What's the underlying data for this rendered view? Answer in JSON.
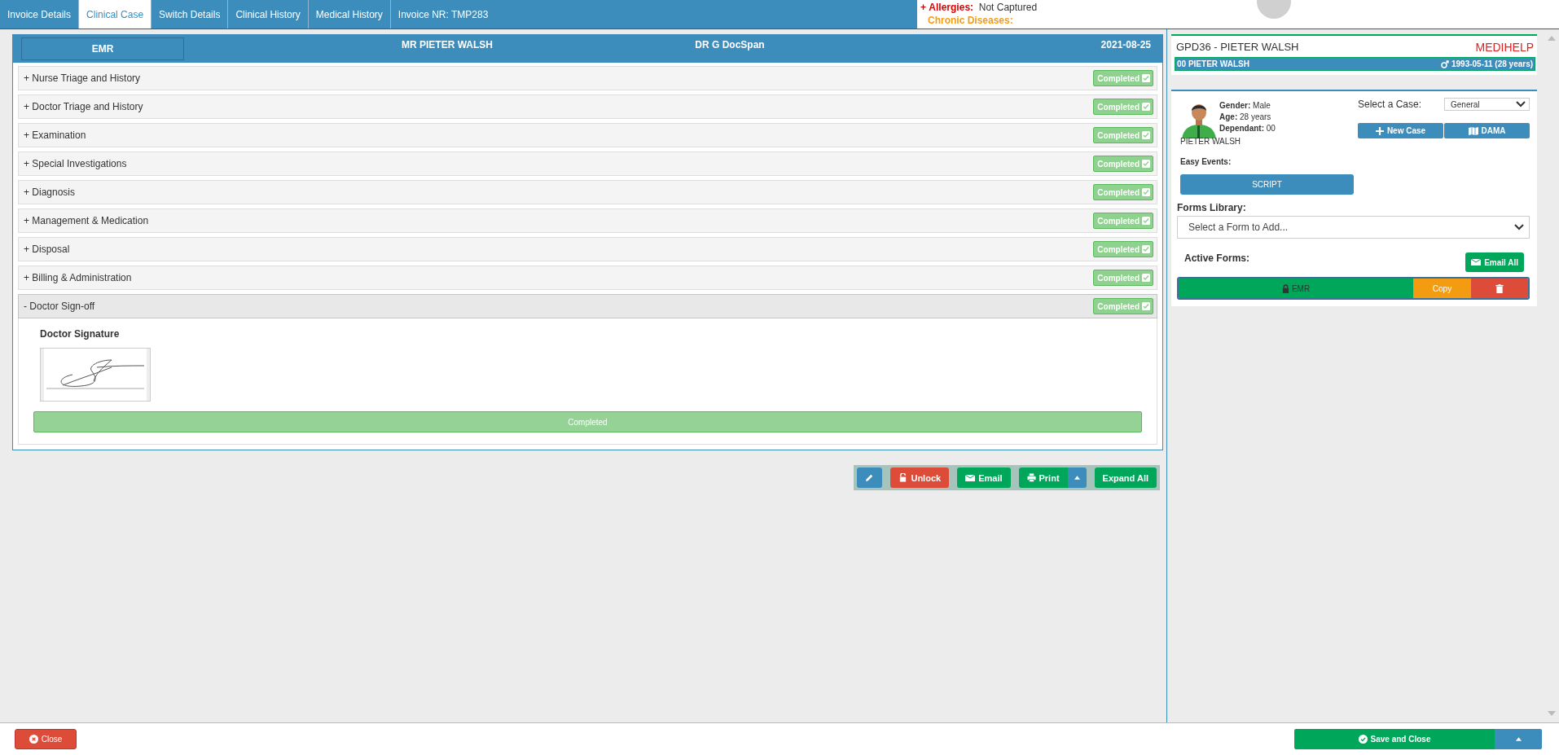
{
  "tabs": [
    {
      "label": "Invoice Details",
      "selected": false
    },
    {
      "label": "Clinical Case",
      "selected": true
    },
    {
      "label": "Switch Details",
      "selected": false
    },
    {
      "label": "Clinical History",
      "selected": false
    },
    {
      "label": "Medical History",
      "selected": false
    },
    {
      "label": "Invoice NR: TMP283",
      "selected": false
    }
  ],
  "alerts": {
    "toggle": "+",
    "allergies_label": "Allergies:",
    "allergies_value": "Not Captured",
    "chronic_label": "Chronic Diseases:"
  },
  "emr": {
    "label": "EMR",
    "patient": "MR PIETER WALSH",
    "doctor": "DR G DocSpan",
    "date": "2021-08-25",
    "sections": [
      {
        "toggle": "+",
        "title": "Nurse Triage and History",
        "status": "Completed",
        "expanded": false
      },
      {
        "toggle": "+",
        "title": "Doctor Triage and History",
        "status": "Completed",
        "expanded": false
      },
      {
        "toggle": "+",
        "title": "Examination",
        "status": "Completed",
        "expanded": false
      },
      {
        "toggle": "+",
        "title": "Special Investigations",
        "status": "Completed",
        "expanded": false
      },
      {
        "toggle": "+",
        "title": "Diagnosis",
        "status": "Completed",
        "expanded": false
      },
      {
        "toggle": "+",
        "title": "Management & Medication",
        "status": "Completed",
        "expanded": false
      },
      {
        "toggle": "+",
        "title": "Disposal",
        "status": "Completed",
        "expanded": false
      },
      {
        "toggle": "+",
        "title": "Billing & Administration",
        "status": "Completed",
        "expanded": false
      },
      {
        "toggle": "-",
        "title": "Doctor Sign-off",
        "status": "Completed",
        "expanded": true,
        "signature_label": "Doctor Signature",
        "footer_status": "Completed"
      }
    ]
  },
  "toolbar": [
    {
      "kind": "edit"
    },
    {
      "kind": "unlock",
      "label": "Unlock"
    },
    {
      "kind": "email",
      "label": "Email"
    },
    {
      "kind": "print",
      "label": "Print"
    },
    {
      "kind": "expand",
      "label": "Expand All"
    }
  ],
  "patient_card": {
    "title": "GPD36 - PIETER WALSH",
    "scheme": "MEDIHELP",
    "member": "00 PIETER WALSH",
    "dob": "1993-05-11 (28 years)"
  },
  "case": {
    "details": [
      "**Gender:** Male",
      "**Age:** 28 years",
      "**Dependant:** 00"
    ],
    "name": "PIETER WALSH",
    "select_label": "Select a Case:",
    "case_value": "General",
    "buttons": [
      {
        "kind": "new",
        "label": "New Case"
      },
      {
        "kind": "dama",
        "label": "DAMA"
      }
    ],
    "easy_events_label": "Easy Events:",
    "easy_events": [
      "SCRIPT"
    ],
    "forms_label": "Forms Library:",
    "forms_placeholder": "Select a Form to Add...",
    "active_label": "Active Forms:",
    "email_all": "Email All",
    "active_forms": [
      {
        "name": "EMR",
        "locked": true,
        "copy_label": "Copy"
      }
    ]
  },
  "footer": {
    "close": "Close",
    "save": "Save and Close"
  }
}
